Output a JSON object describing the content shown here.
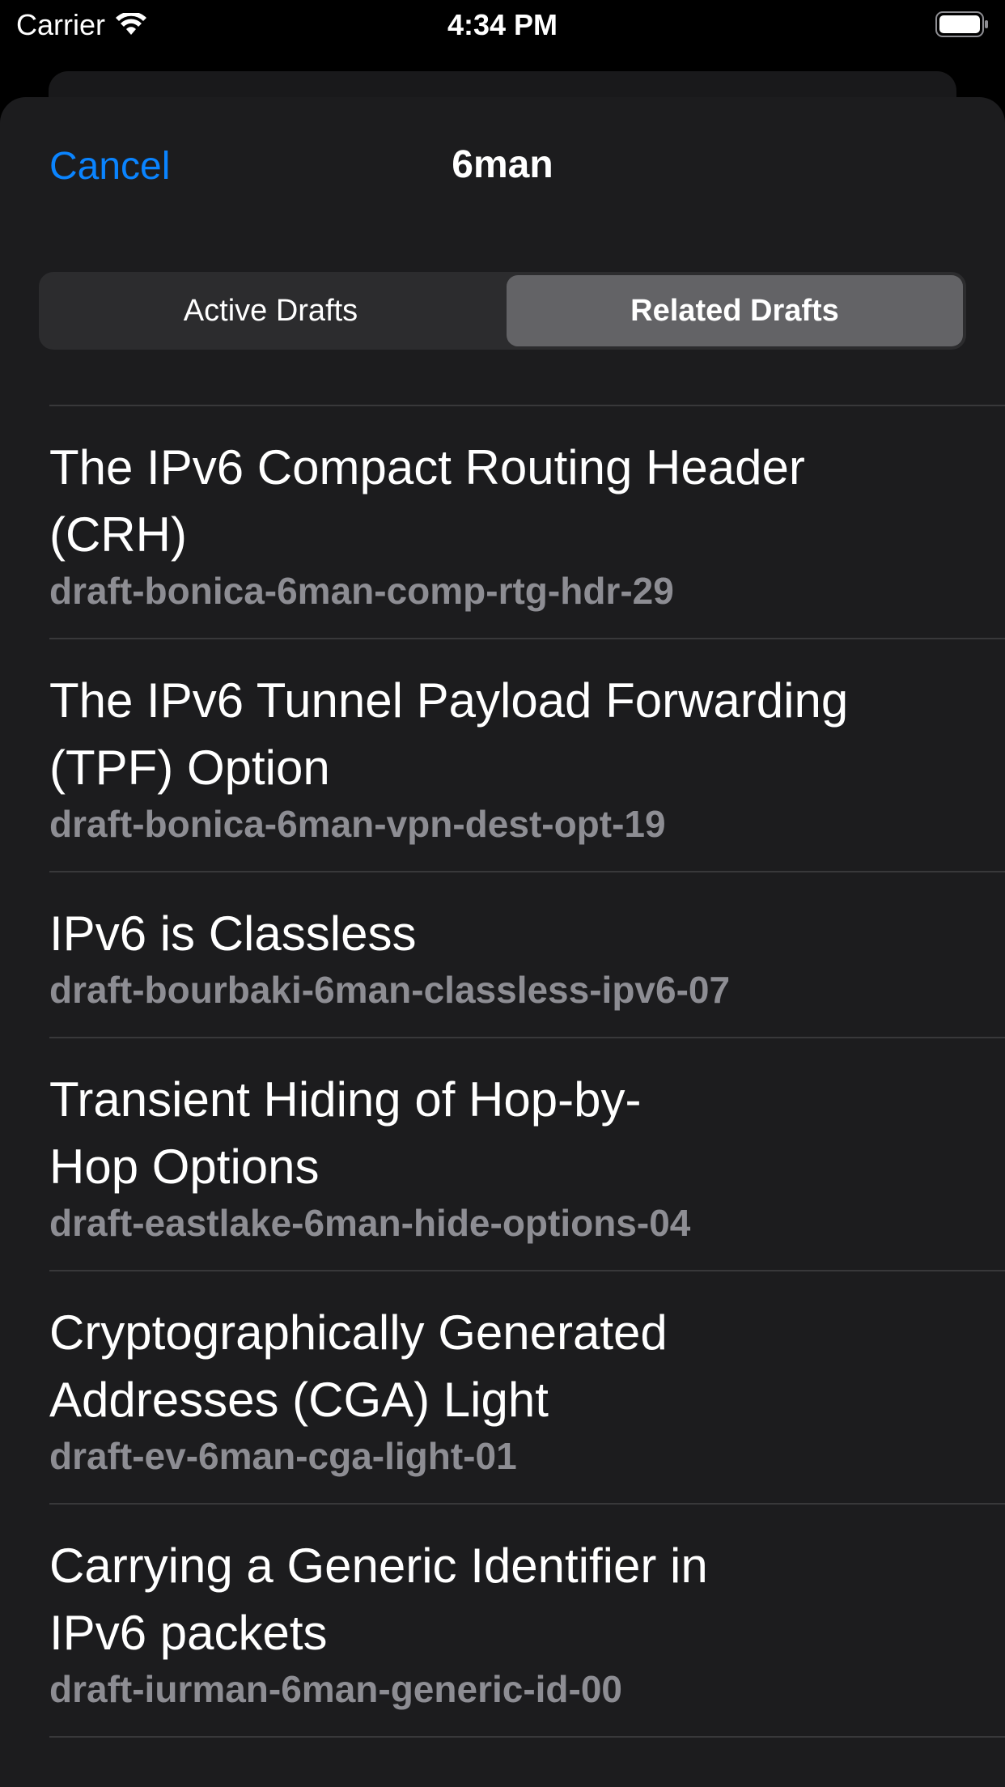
{
  "status_bar": {
    "carrier": "Carrier",
    "time": "4:34 PM"
  },
  "nav": {
    "cancel_label": "Cancel",
    "title": "6man"
  },
  "segments": {
    "active_drafts": "Active Drafts",
    "related_drafts": "Related Drafts",
    "selected": "Related Drafts"
  },
  "drafts": [
    {
      "title_line1": "The IPv6 Compact Routing Header",
      "title_line2": "(CRH)",
      "name": "draft-bonica-6man-comp-rtg-hdr-29"
    },
    {
      "title_line1": "The IPv6 Tunnel Payload Forwarding",
      "title_line2": "(TPF) Option",
      "name": "draft-bonica-6man-vpn-dest-opt-19"
    },
    {
      "title_line1": "IPv6 is Classless",
      "title_line2": "",
      "name": "draft-bourbaki-6man-classless-ipv6-07"
    },
    {
      "title_line1": "Transient Hiding of Hop-by-",
      "title_line2": "Hop Options",
      "name": "draft-eastlake-6man-hide-options-04"
    },
    {
      "title_line1": "Cryptographically Generated",
      "title_line2": "Addresses (CGA) Light",
      "name": "draft-ev-6man-cga-light-01"
    },
    {
      "title_line1": "Carrying a Generic Identifier in",
      "title_line2": "IPv6 packets",
      "name": "draft-iurman-6man-generic-id-00"
    }
  ],
  "colors": {
    "accent": "#0a84ff",
    "background": "#1c1c1e",
    "secondary_text": "#8d8d93",
    "separator": "#38383a",
    "segment_selected": "#636366"
  }
}
